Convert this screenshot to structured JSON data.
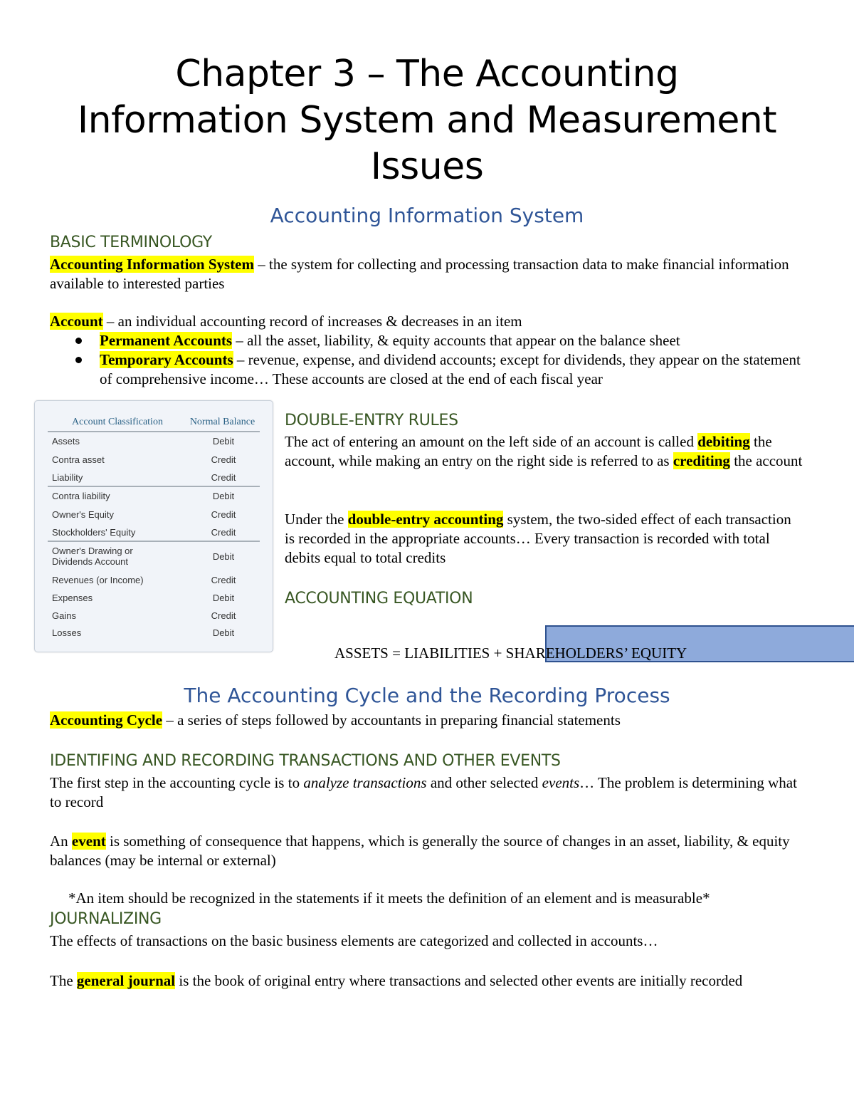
{
  "document": {
    "title": "Chapter 3 – The Accounting Information System and Measurement Issues",
    "title_lines": [
      "Chapter 3 – The Accounting",
      "Information System and Measurement",
      "Issues"
    ],
    "section1": {
      "title": "Accounting Information System",
      "basic_terminology": {
        "heading": "BASIC TERMINOLOGY",
        "ais_term": "Accounting Information System",
        "ais_def": " – the system for collecting and processing transaction data to make financial information available to interested parties",
        "account_term": "Account",
        "account_def": " – an individual accounting record of increases & decreases in an item",
        "bullets": [
          {
            "term": "Permanent Accounts",
            "def": " – all the asset, liability, & equity accounts that appear on the balance sheet"
          },
          {
            "term": "Temporary Accounts",
            "def": " – revenue, expense, and dividend accounts; except for dividends, they appear on the statement of comprehensive income… These accounts are closed at the end of each fiscal year"
          }
        ]
      },
      "table": {
        "headers": [
          "Account Classification",
          "Normal Balance"
        ],
        "rows": [
          {
            "classification": "Assets",
            "balance": "Debit"
          },
          {
            "classification": "Contra asset",
            "balance": "Credit"
          },
          {
            "classification": "Liability",
            "balance": "Credit"
          },
          {
            "classification": "Contra liability",
            "balance": "Debit"
          },
          {
            "classification": "Owner's Equity",
            "balance": "Credit"
          },
          {
            "classification": "Stockholders' Equity",
            "balance": "Credit"
          },
          {
            "classification": "Owner's Drawing or Dividends Account",
            "balance": "Debit"
          },
          {
            "classification": "Revenues (or Income)",
            "balance": "Credit"
          },
          {
            "classification": "Expenses",
            "balance": "Debit"
          },
          {
            "classification": "Gains",
            "balance": "Credit"
          },
          {
            "classification": "Losses",
            "balance": "Debit"
          }
        ]
      },
      "double_entry": {
        "heading": "DOUBLE-ENTRY RULES",
        "p1_a": "The act of entering an amount on the left side of an account is called ",
        "p1_term1": "debiting",
        "p1_b": " the account, while making an entry on the right side is referred to as ",
        "p1_term2": "crediting",
        "p1_c": " the account",
        "p2_a": "Under the ",
        "p2_term": "double-entry accounting",
        "p2_b": " system, the two-sided effect of each transaction is recorded in the appropriate accounts… Every transaction is recorded with total debits equal to total credits"
      },
      "equation": {
        "heading": "ACCOUNTING EQUATION",
        "text": "ASSETS = LIABILITIES + SHAREHOLDERS’ EQUITY"
      }
    },
    "section2": {
      "title": "The Accounting Cycle and the Recording Process",
      "cycle_term": "Accounting Cycle",
      "cycle_def": " – a series of steps followed by accountants in preparing financial statements",
      "identifying": {
        "heading": "IDENTIFING AND RECORDING TRANSACTIONS AND OTHER EVENTS",
        "p1_a": "The first step in the accounting cycle is to ",
        "p1_em1": "analyze transactions",
        "p1_b": " and other selected ",
        "p1_em2": "events",
        "p1_c": "… The problem is determining what to record",
        "p2_a": "An ",
        "p2_term": "event",
        "p2_b": " is something of consequence that happens, which is generally the source of changes in an asset, liability, & equity balances (may be internal or external)",
        "note": "*An item should be recognized in the statements if it meets the definition of an element and is measurable*"
      },
      "journalizing": {
        "heading": "JOURNALIZING",
        "p1": "The effects of transactions on the basic business elements are categorized and collected in accounts…",
        "p2_a": "The ",
        "p2_term": "general journal",
        "p2_b": " is the book of original entry where transactions and selected other events are initially recorded"
      }
    }
  }
}
